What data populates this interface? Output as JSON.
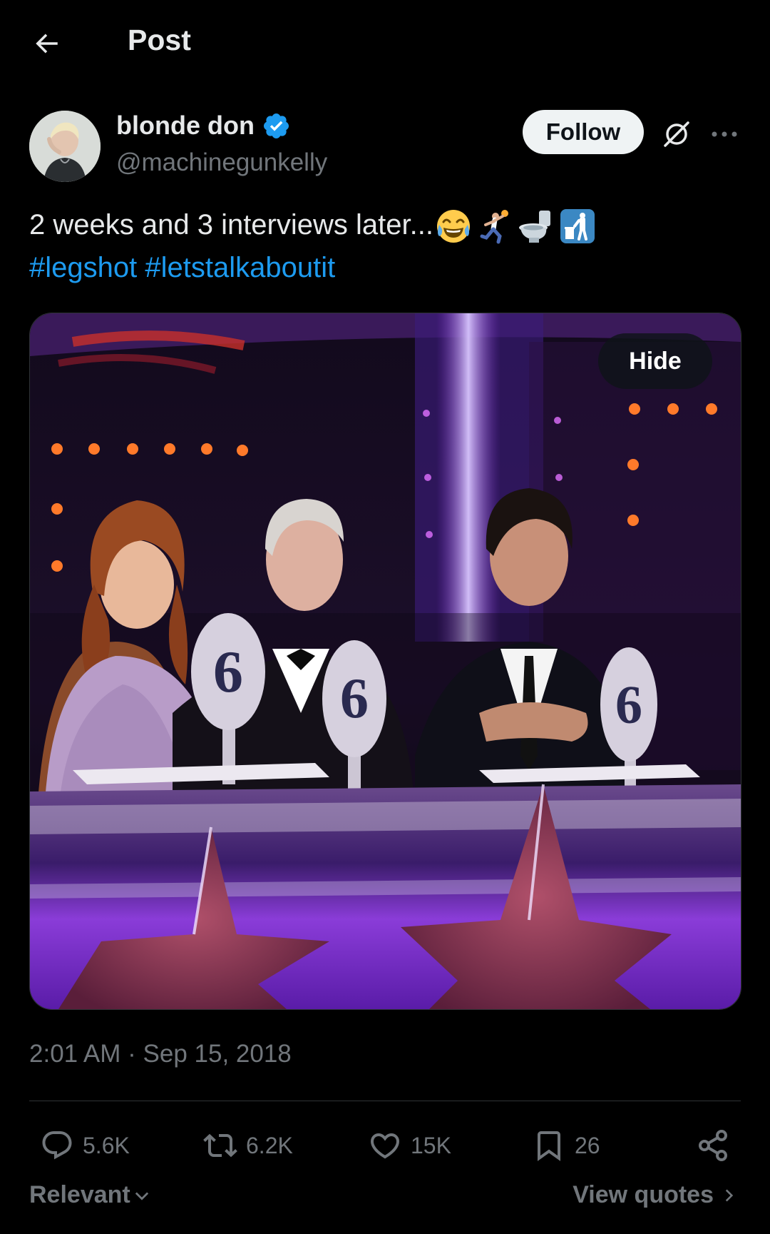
{
  "header": {
    "title": "Post",
    "back_icon": "arrow-left-icon"
  },
  "author": {
    "display_name": "blonde don",
    "handle": "@machinegunkelly",
    "verified": true,
    "follow_label": "Follow"
  },
  "post": {
    "text": "2 weeks and 3 interviews later...",
    "emojis": [
      "joy-emoji",
      "handball-emoji",
      "toilet-emoji",
      "litter-bin-emoji"
    ],
    "hashtags": [
      "#legshot",
      "#letstalkaboutit"
    ],
    "media": {
      "hide_label": "Hide",
      "paddle_values": [
        "6",
        "6",
        "6"
      ]
    },
    "time": "2:01 AM",
    "separator": " · ",
    "date": "Sep 15, 2018"
  },
  "actions": {
    "replies": "5.6K",
    "reposts": "6.2K",
    "likes": "15K",
    "bookmarks": "26"
  },
  "footer": {
    "sort_label": "Relevant",
    "view_quotes_label": "View quotes"
  },
  "colors": {
    "background": "#000000",
    "text_primary": "#e7e9ea",
    "text_secondary": "#71767b",
    "accent": "#1d9bf0",
    "divider": "#2f3336"
  }
}
